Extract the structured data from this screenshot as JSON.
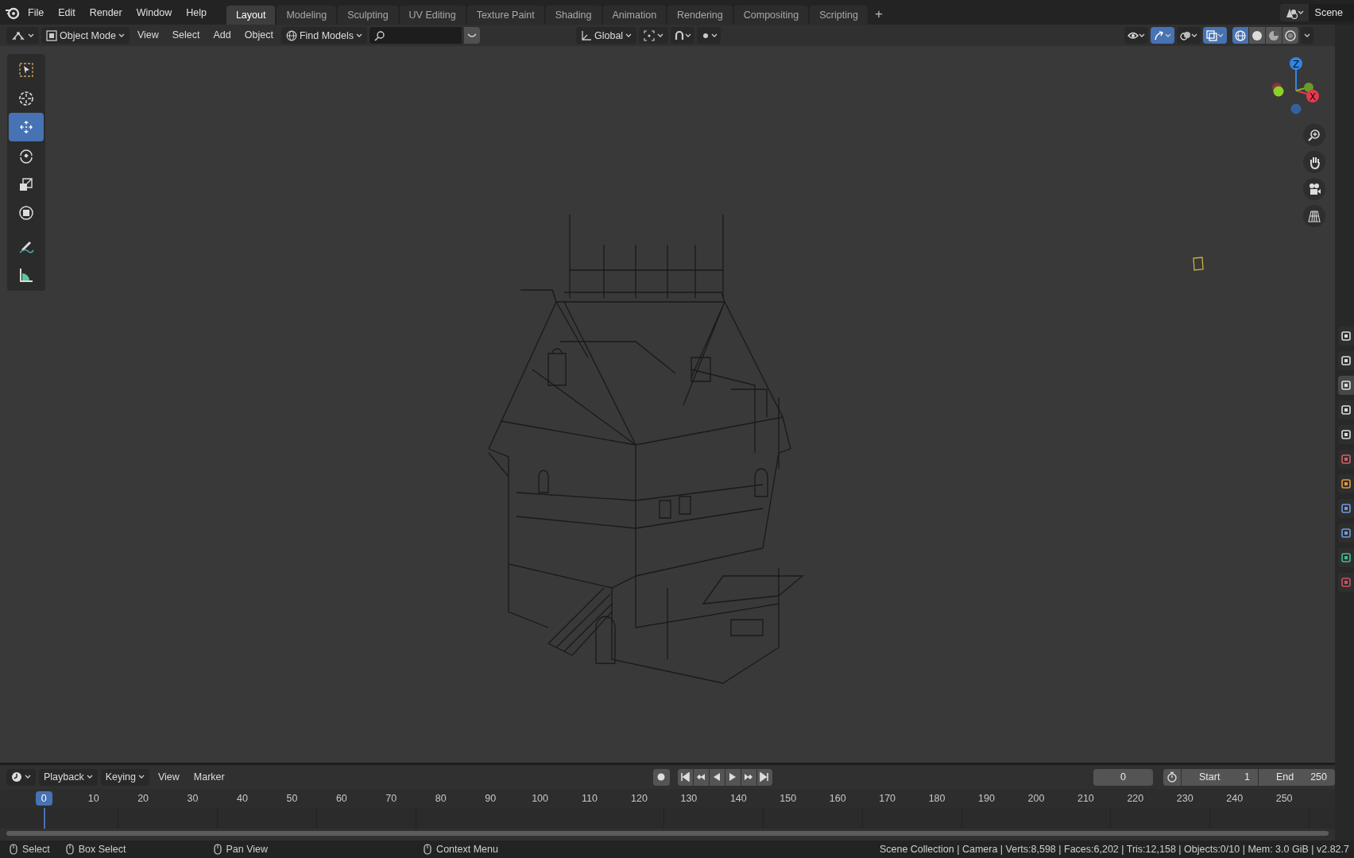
{
  "topbar": {
    "menus": [
      "File",
      "Edit",
      "Render",
      "Window",
      "Help"
    ],
    "workspaces": [
      {
        "label": "Layout",
        "selected": true
      },
      {
        "label": "Modeling",
        "selected": false
      },
      {
        "label": "Sculpting",
        "selected": false
      },
      {
        "label": "UV Editing",
        "selected": false
      },
      {
        "label": "Texture Paint",
        "selected": false
      },
      {
        "label": "Shading",
        "selected": false
      },
      {
        "label": "Animation",
        "selected": false
      },
      {
        "label": "Rendering",
        "selected": false
      },
      {
        "label": "Compositing",
        "selected": false
      },
      {
        "label": "Scripting",
        "selected": false
      }
    ],
    "add_tab": "+",
    "scene": "Scene"
  },
  "header": {
    "mode": "Object Mode",
    "menus": [
      "View",
      "Select",
      "Add",
      "Object"
    ],
    "find_models": "Find Models",
    "orientation": "Global",
    "center_toggles": [
      {
        "kind": "snap",
        "on": false
      },
      {
        "kind": "proportional",
        "on": false
      }
    ],
    "view_toggles": [
      {
        "kind": "visibility",
        "on": false
      },
      {
        "kind": "gizmos",
        "on": true
      },
      {
        "kind": "overlays",
        "on": false
      },
      {
        "kind": "xray",
        "on": true
      }
    ],
    "shading": [
      {
        "kind": "wireframe",
        "selected": true
      },
      {
        "kind": "solid",
        "selected": false
      },
      {
        "kind": "material",
        "selected": false
      },
      {
        "kind": "rendered",
        "selected": false
      }
    ]
  },
  "tools": [
    {
      "kind": "select_box",
      "selected": false
    },
    {
      "kind": "cursor",
      "selected": false
    },
    {
      "kind": "move",
      "selected": true
    },
    {
      "kind": "rotate",
      "selected": false
    },
    {
      "kind": "scale",
      "selected": false
    },
    {
      "kind": "transform",
      "selected": false
    },
    {
      "kind": "annotate",
      "selected": false
    },
    {
      "kind": "measure",
      "selected": false
    }
  ],
  "navigation_gizmo": {
    "axes": [
      "Z",
      "X"
    ]
  },
  "timeline": {
    "dropdowns": [
      "Playback",
      "Keying"
    ],
    "menus": [
      "View",
      "Marker"
    ],
    "frame": "0",
    "start_label": "Start",
    "start": "1",
    "end_label": "End",
    "end": "250",
    "current_frame": "0",
    "ruler": [
      "10",
      "20",
      "30",
      "40",
      "50",
      "60",
      "70",
      "80",
      "90",
      "100",
      "110",
      "120",
      "130",
      "140",
      "150",
      "160",
      "170",
      "180",
      "190",
      "200",
      "210",
      "220",
      "230",
      "240",
      "250"
    ]
  },
  "status_bar": {
    "hints": [
      "Select",
      "Box Select",
      "Pan View",
      "Context Menu"
    ],
    "stats": "Scene Collection | Camera | Verts:8,598 | Faces:6,202 | Tris:12,158 | Objects:0/10 | Mem: 3.0 GiB | v2.82.7"
  },
  "properties_tabs": [
    {
      "kind": "tool",
      "selected": false
    },
    {
      "kind": "render",
      "selected": false
    },
    {
      "kind": "output",
      "selected": true
    },
    {
      "kind": "view_layer",
      "selected": false
    },
    {
      "kind": "scene",
      "selected": false
    },
    {
      "kind": "world",
      "selected": false
    },
    {
      "kind": "object",
      "selected": false
    },
    {
      "kind": "modifiers",
      "selected": false
    },
    {
      "kind": "physics",
      "selected": false
    },
    {
      "kind": "constraints",
      "selected": false
    },
    {
      "kind": "texture",
      "selected": false
    }
  ]
}
